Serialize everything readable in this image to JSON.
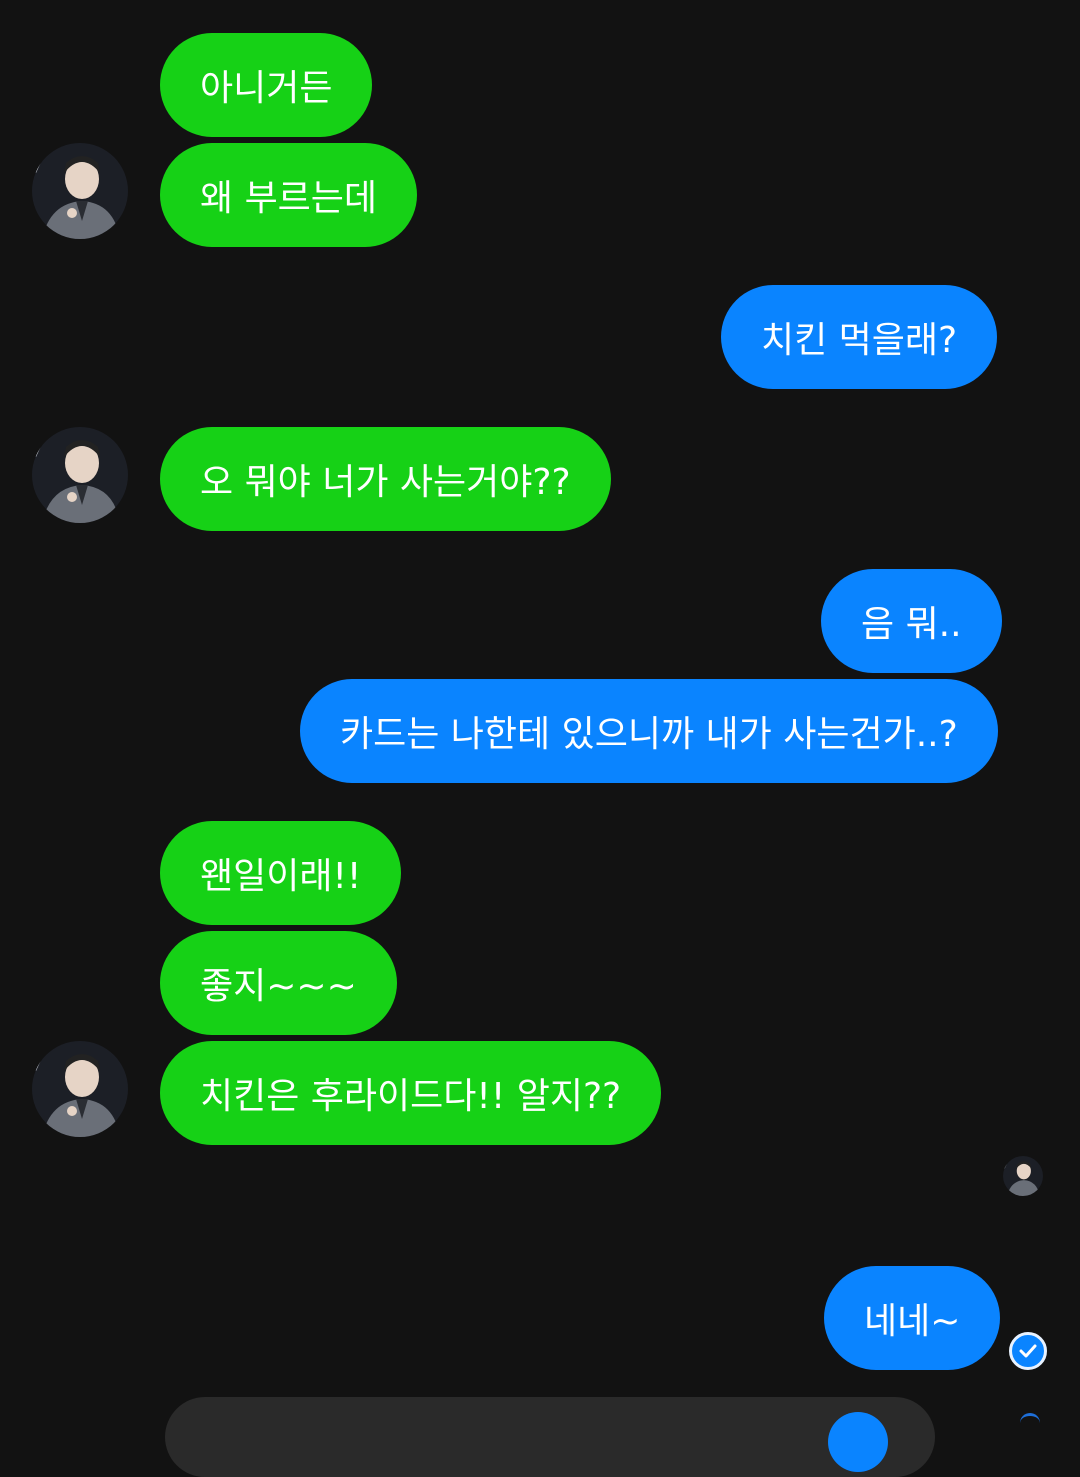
{
  "colors": {
    "background": "#121212",
    "incoming_bubble": "#16d116",
    "outgoing_bubble": "#0a84ff",
    "bubble_text": "#ffffff"
  },
  "messages": [
    {
      "side": "incoming",
      "text": "아니거든"
    },
    {
      "side": "incoming",
      "text": "왜 부르는데"
    },
    {
      "side": "outgoing",
      "text": "치킨 먹을래?"
    },
    {
      "side": "incoming",
      "text": "오 뭐야 너가 사는거야??"
    },
    {
      "side": "outgoing",
      "text": "음 뭐.."
    },
    {
      "side": "outgoing",
      "text": "카드는 나한테 있으니까 내가 사는건가..?"
    },
    {
      "side": "incoming",
      "text": "왠일이래!!"
    },
    {
      "side": "incoming",
      "text": "좋지~~~"
    },
    {
      "side": "incoming",
      "text": "치킨은 후라이드다!! 알지??"
    },
    {
      "side": "outgoing",
      "text": "네네~"
    }
  ],
  "icons": {
    "contact_avatar": "avatar-photo",
    "seen_indicator": "avatar-thumbnail",
    "read_receipt": "check-circle-icon"
  }
}
